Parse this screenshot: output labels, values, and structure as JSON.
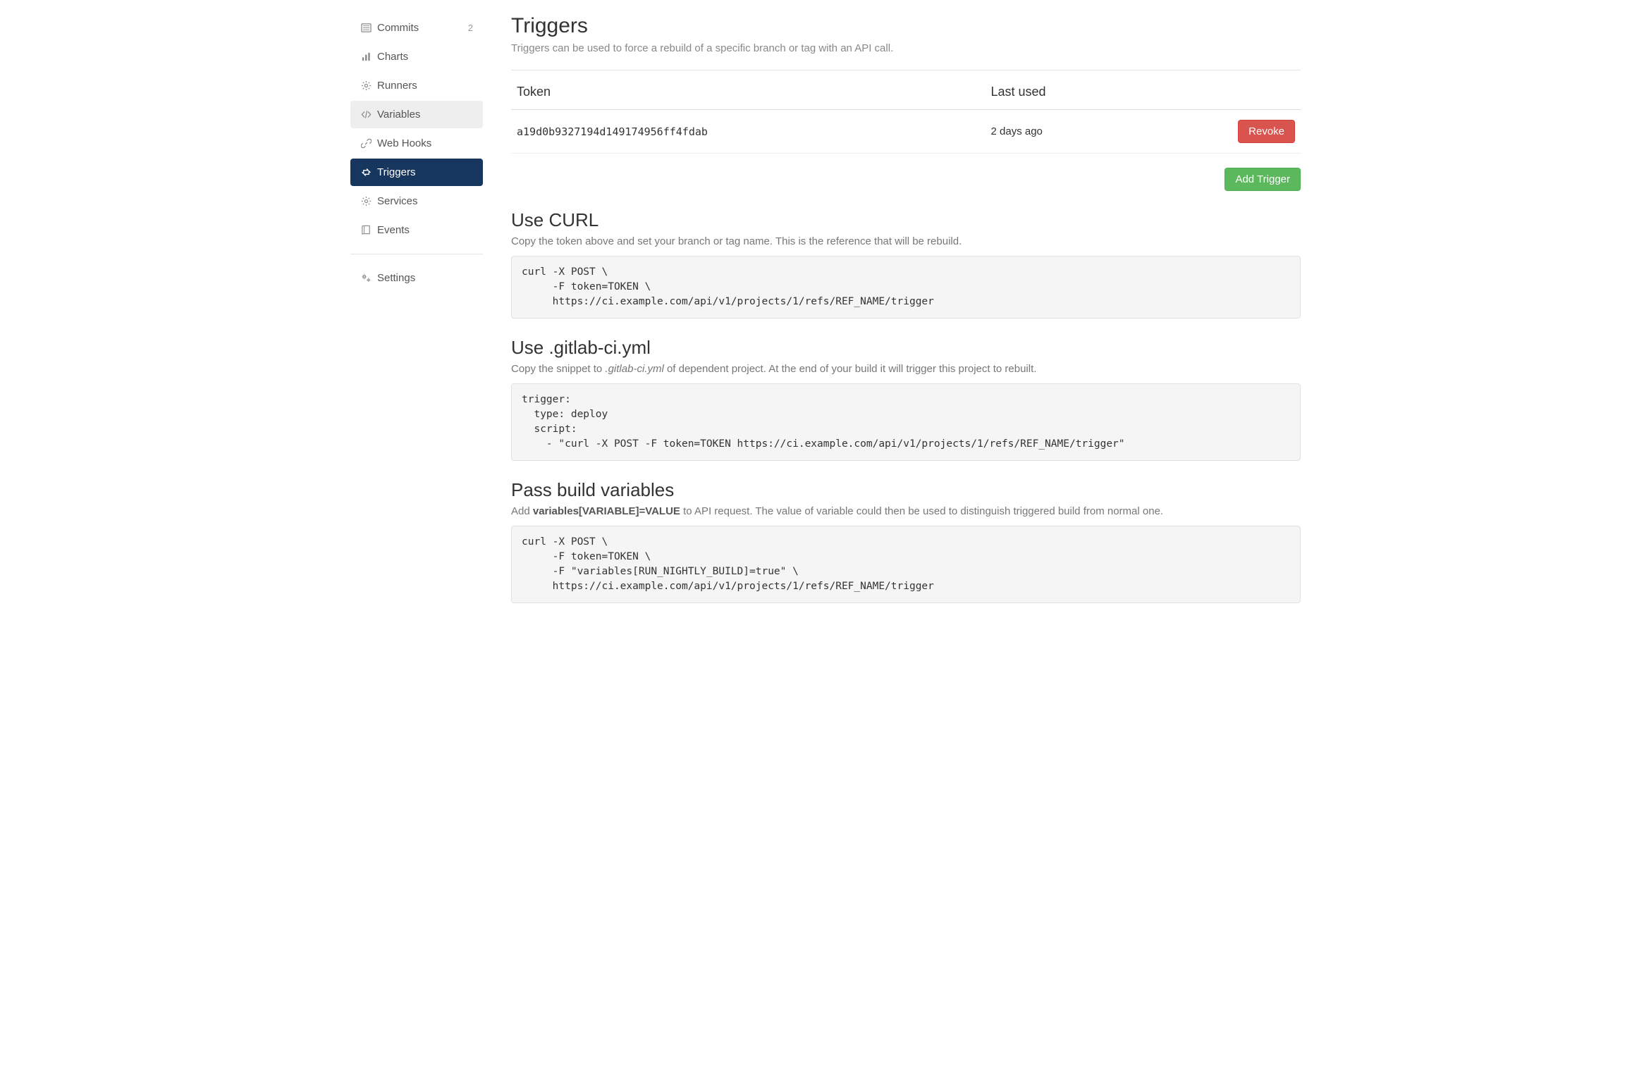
{
  "sidebar": {
    "items": [
      {
        "label": "Commits",
        "icon": "list-icon",
        "badge": "2",
        "state": ""
      },
      {
        "label": "Charts",
        "icon": "chart-icon",
        "badge": "",
        "state": ""
      },
      {
        "label": "Runners",
        "icon": "gear-icon",
        "badge": "",
        "state": ""
      },
      {
        "label": "Variables",
        "icon": "code-icon",
        "badge": "",
        "state": "light"
      },
      {
        "label": "Web Hooks",
        "icon": "link-icon",
        "badge": "",
        "state": ""
      },
      {
        "label": "Triggers",
        "icon": "retweet-icon",
        "badge": "",
        "state": "active"
      },
      {
        "label": "Services",
        "icon": "gear-icon",
        "badge": "",
        "state": ""
      },
      {
        "label": "Events",
        "icon": "book-icon",
        "badge": "",
        "state": ""
      }
    ],
    "settings_label": "Settings"
  },
  "page": {
    "title": "Triggers",
    "subtitle": "Triggers can be used to force a rebuild of a specific branch or tag with an API call."
  },
  "table": {
    "col_token": "Token",
    "col_last_used": "Last used",
    "rows": [
      {
        "token": "a19d0b9327194d149174956ff4fdab",
        "last_used": "2 days ago",
        "revoke_label": "Revoke"
      }
    ]
  },
  "add_trigger_label": "Add Trigger",
  "curl": {
    "title": "Use CURL",
    "desc": "Copy the token above and set your branch or tag name. This is the reference that will be rebuild.",
    "code": "curl -X POST \\\n     -F token=TOKEN \\\n     https://ci.example.com/api/v1/projects/1/refs/REF_NAME/trigger"
  },
  "yml": {
    "title": "Use .gitlab-ci.yml",
    "desc_prefix": "Copy the snippet to ",
    "desc_em": ".gitlab-ci.yml",
    "desc_suffix": " of dependent project. At the end of your build it will trigger this project to rebuilt.",
    "code": "trigger:\n  type: deploy\n  script:\n    - \"curl -X POST -F token=TOKEN https://ci.example.com/api/v1/projects/1/refs/REF_NAME/trigger\""
  },
  "vars": {
    "title": "Pass build variables",
    "desc_prefix": "Add ",
    "desc_bold": "variables[VARIABLE]=VALUE",
    "desc_suffix": " to API request. The value of variable could then be used to distinguish triggered build from normal one.",
    "code": "curl -X POST \\\n     -F token=TOKEN \\\n     -F \"variables[RUN_NIGHTLY_BUILD]=true\" \\\n     https://ci.example.com/api/v1/projects/1/refs/REF_NAME/trigger"
  }
}
